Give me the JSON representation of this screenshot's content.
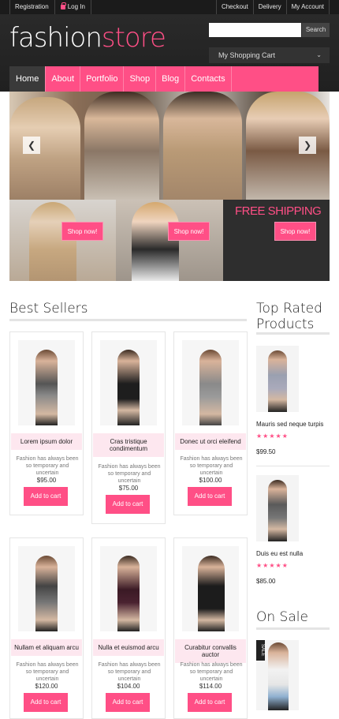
{
  "topbar": {
    "registration": "Registration",
    "login": "Log In",
    "checkout": "Checkout",
    "delivery": "Delivery",
    "my_account": "My Account"
  },
  "header": {
    "logo_part1": "fashion",
    "logo_part2": "store",
    "search_button": "Search",
    "search_placeholder": "",
    "cart_label": "My Shopping Cart"
  },
  "nav": {
    "items": [
      "Home",
      "About",
      "Portfolio",
      "Shop",
      "Blog",
      "Contacts"
    ]
  },
  "promos": {
    "shop_now": "Shop now!",
    "free_shipping": "FREE SHIPPING"
  },
  "best_sellers": {
    "title": "Best Sellers",
    "products": [
      {
        "name": "Lorem ipsum dolor",
        "desc": "Fashion has always been so temporary and uncertain",
        "price": "$95.00",
        "add": "Add to cart"
      },
      {
        "name": "Cras tristique condimentum",
        "desc": "Fashion has always been so temporary and uncertain",
        "price": "$75.00",
        "add": "Add to cart"
      },
      {
        "name": "Donec ut orci eleifend",
        "desc": "Fashion has always been so temporary and uncertain",
        "price": "$100.00",
        "add": "Add to cart"
      },
      {
        "name": "Nullam et aliquam arcu",
        "desc": "Fashion has always been so temporary and uncertain",
        "price": "$120.00",
        "add": "Add to cart"
      },
      {
        "name": "Nulla et euismod arcu",
        "desc": "Fashion has always been so temporary and uncertain",
        "price": "$104.00",
        "add": "Add to cart"
      },
      {
        "name": "Curabitur convallis auctor",
        "desc": "Fashion has always been so temporary and uncertain",
        "price": "$114.00",
        "add": "Add to cart"
      }
    ]
  },
  "top_rated": {
    "title_line1": "Top Rated",
    "title_line2": "Products",
    "items": [
      {
        "name": "Mauris sed neque turpis",
        "rating": 5,
        "stars": "★★★★★",
        "price": "$99.50"
      },
      {
        "name": "Duis eu est nulla",
        "rating": 5,
        "stars": "★★★★★",
        "price": "$85.00"
      }
    ]
  },
  "on_sale": {
    "title": "On Sale",
    "badge": "SALE"
  },
  "colors": {
    "accent": "#ff4f86",
    "dark": "#222222"
  }
}
